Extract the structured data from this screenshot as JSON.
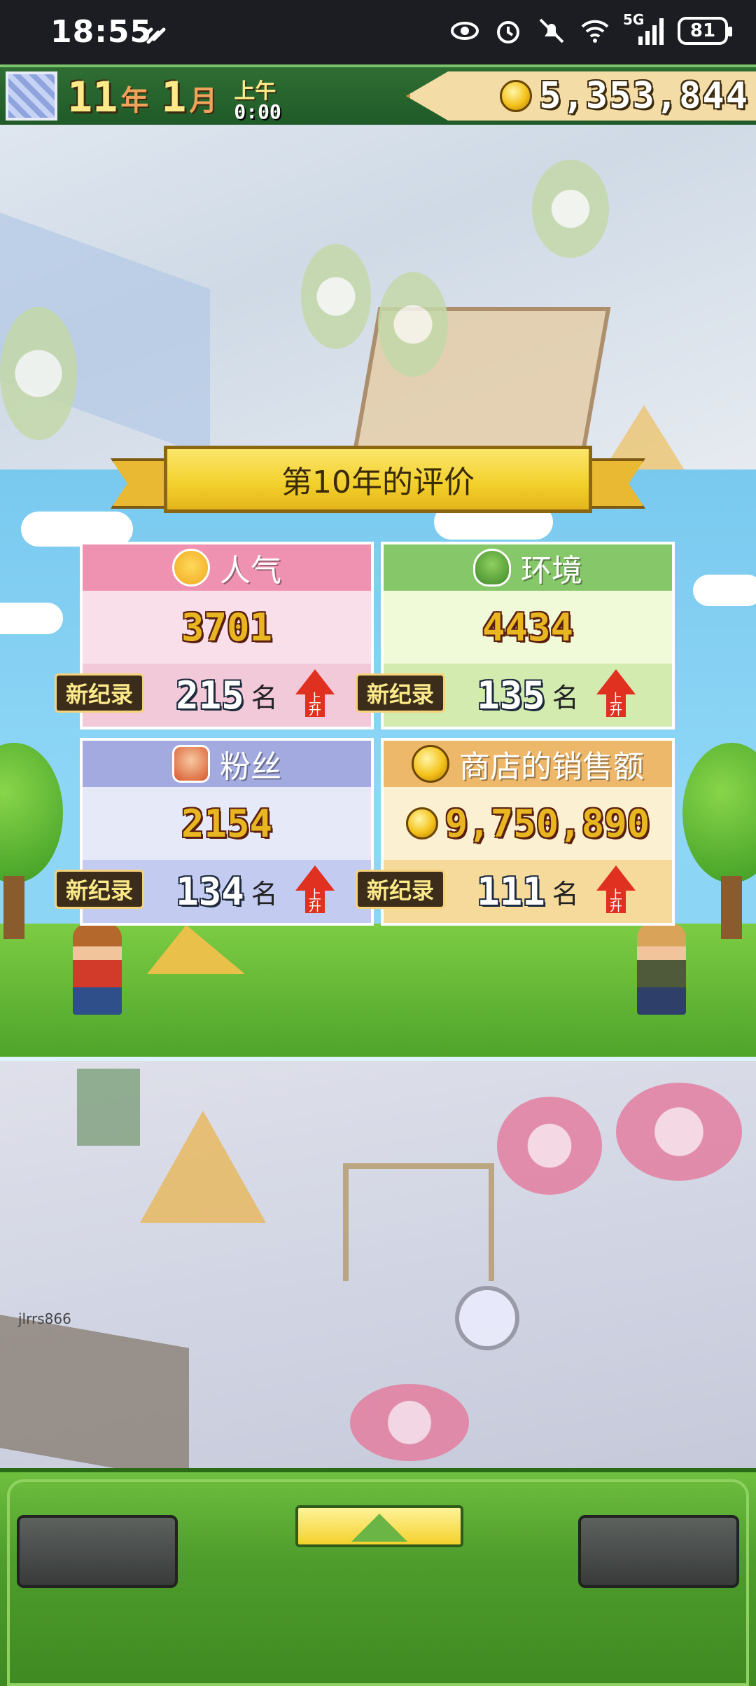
{
  "status_bar": {
    "time": "18:55",
    "network": "5G",
    "battery": "81"
  },
  "hud": {
    "year": "11",
    "year_unit": "年",
    "month": "1",
    "month_unit": "月",
    "ampm": "上午",
    "clock": "0:00",
    "money": "5,353,844"
  },
  "evaluation": {
    "title": "第10年的评价",
    "cards": {
      "popularity": {
        "label": "人气",
        "value": "3701",
        "badge": "新纪录",
        "rank": "215",
        "rank_unit": "名",
        "trend": "上升"
      },
      "environment": {
        "label": "环境",
        "value": "4434",
        "badge": "新纪录",
        "rank": "135",
        "rank_unit": "名",
        "trend": "上升"
      },
      "fans": {
        "label": "粉丝",
        "value": "2154",
        "badge": "新纪录",
        "rank": "134",
        "rank_unit": "名",
        "trend": "上升"
      },
      "shop_sales": {
        "label": "商店的销售额",
        "value": "9,750,890",
        "badge": "新纪录",
        "rank": "111",
        "rank_unit": "名",
        "trend": "上升"
      }
    }
  },
  "watermark": "jlrrs866",
  "colors": {
    "popularity": "#ef92b2",
    "environment": "#86c76a",
    "fans": "#a2aadf",
    "shop_sales": "#eeb86a"
  }
}
